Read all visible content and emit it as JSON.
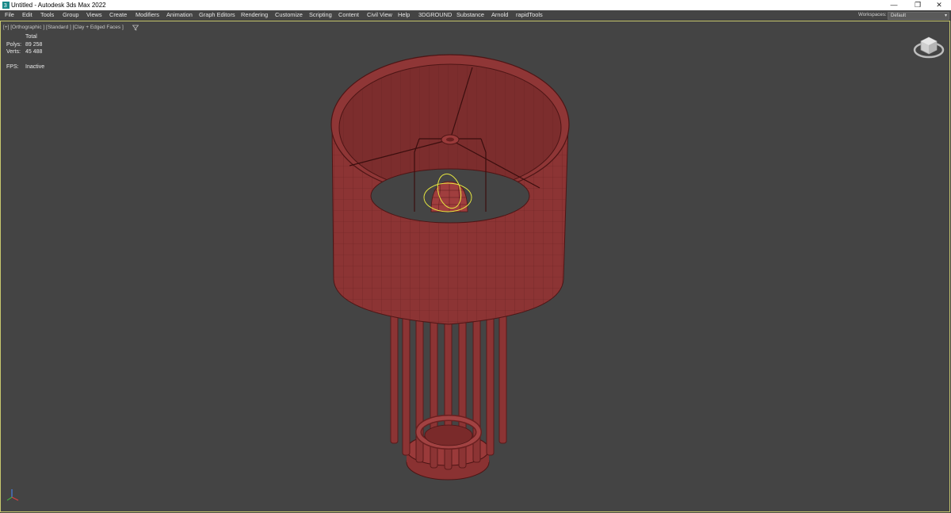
{
  "titlebar": {
    "title": "Untitled - Autodesk 3ds Max 2022",
    "minimize": "—",
    "restore": "❐",
    "close": "✕"
  },
  "menu": [
    "File",
    "Edit",
    "Tools",
    "Group",
    "Views",
    "Create",
    "Modifiers",
    "Animation",
    "Graph Editors",
    "Rendering",
    "Customize",
    "Scripting",
    "Content",
    "Civil View",
    "Help",
    "3DGROUND",
    "Substance",
    "Arnold",
    "rapidTools"
  ],
  "workspace": {
    "label": "Workspaces:",
    "value": "Default"
  },
  "viewport": {
    "label": "[+] [Orthographic ] [Standard ] [Clay + Edged Faces ]",
    "stats": {
      "header": "Total",
      "polys_label": "Polys:",
      "polys": "89 258",
      "verts_label": "Verts:",
      "verts": "45 488",
      "fps_label": "FPS:",
      "fps": "Inactive"
    }
  },
  "colors": {
    "viewport_bg": "#444444",
    "model_fill": "#8f3535",
    "model_edge": "#5a1a1a",
    "selection": "#e6e640",
    "titlebar_bg": "#ffffff"
  },
  "icons": [
    "app-icon",
    "filter-icon",
    "viewcube-icon",
    "axis-tripod-icon"
  ]
}
